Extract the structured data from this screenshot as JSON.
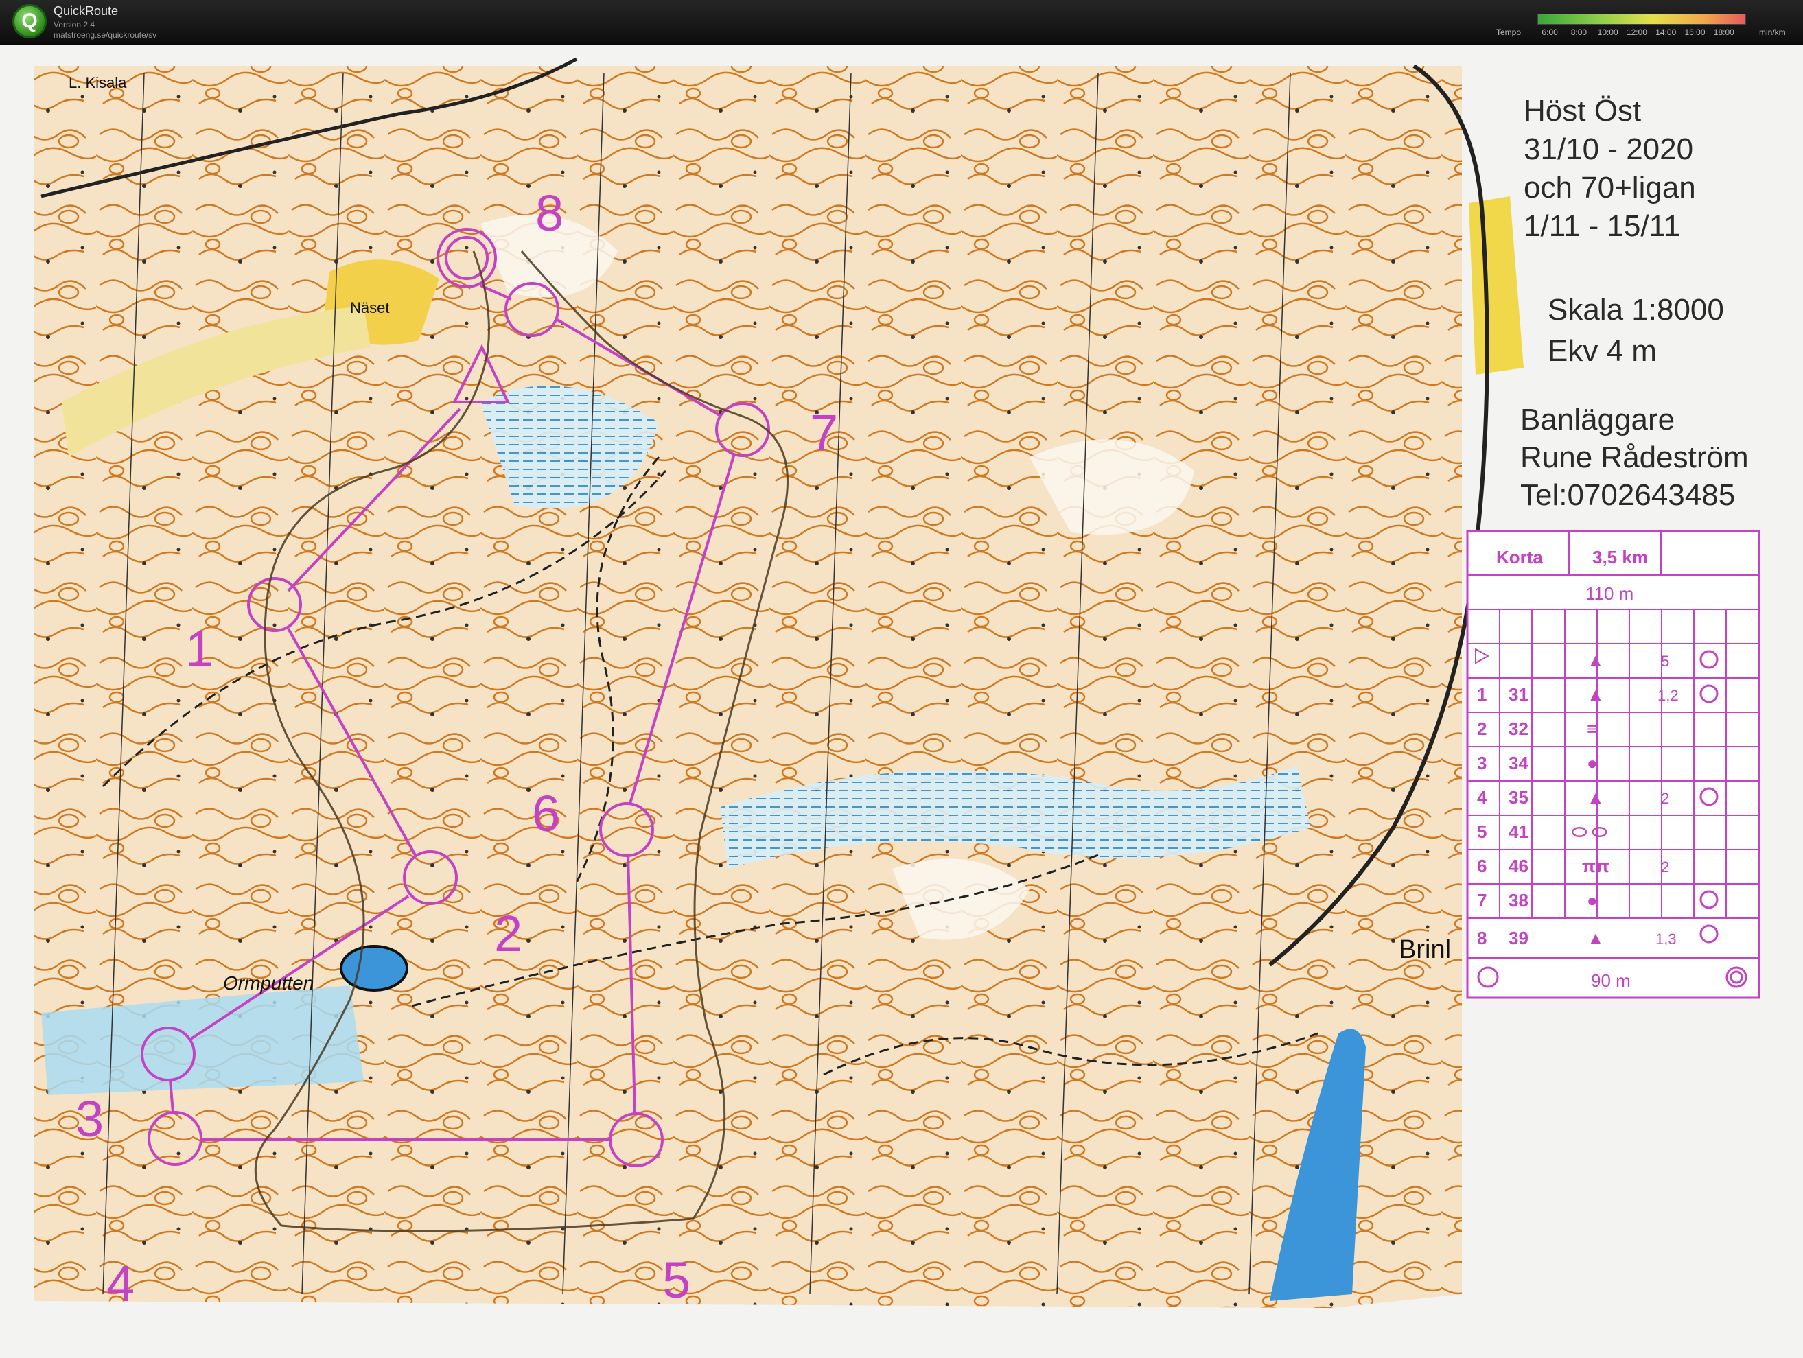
{
  "app": {
    "name": "QuickRoute",
    "version": "Version 2.4",
    "url": "matstroeng.se/quickroute/sv",
    "logo_letter": "Q",
    "tempo_label": "Tempo",
    "tempo_ticks": [
      "6:00",
      "8:00",
      "10:00",
      "12:00",
      "14:00",
      "16:00",
      "18:00"
    ],
    "tempo_unit": "min/km"
  },
  "map": {
    "event_title": [
      "Höst Öst",
      "31/10 - 2020",
      "och 70+ligan",
      "1/11 - 15/11"
    ],
    "scale": "Skala 1:8000",
    "contour": "Ekv 4 m",
    "setter_label": "Banläggare",
    "setter_name": "Rune Rådeström",
    "phone": "Tel:0702643485",
    "place_names": [
      "L. Kisala",
      "Näset",
      "Ormputten",
      "Brinl"
    ],
    "control_numbers": [
      "1",
      "2",
      "3",
      "4",
      "5",
      "6",
      "7",
      "8"
    ]
  },
  "description_sheet": {
    "course": "Korta",
    "length": "3,5 km",
    "start_distance": "110 m",
    "finish_distance": "90 m",
    "rows": [
      {
        "num": "",
        "code": "",
        "sym": "▲",
        "dim": "5"
      },
      {
        "num": "1",
        "code": "31",
        "sym": "▲",
        "dim": "1,2"
      },
      {
        "num": "2",
        "code": "32",
        "sym": "≡",
        "dim": ""
      },
      {
        "num": "3",
        "code": "34",
        "sym": "●",
        "dim": ""
      },
      {
        "num": "4",
        "code": "35",
        "sym": "▲",
        "dim": "2"
      },
      {
        "num": "5",
        "code": "41",
        "sym": "⬭ ⬭",
        "dim": ""
      },
      {
        "num": "6",
        "code": "46",
        "sym": "ππ",
        "dim": "2"
      },
      {
        "num": "7",
        "code": "38",
        "sym": "●",
        "dim": ""
      },
      {
        "num": "8",
        "code": "39",
        "sym": "▲",
        "dim": "1,3"
      }
    ]
  },
  "colors": {
    "course": "#c040c0",
    "contour": "#c8741a",
    "water": "#7ec8ea",
    "route": "#4a3a20"
  }
}
